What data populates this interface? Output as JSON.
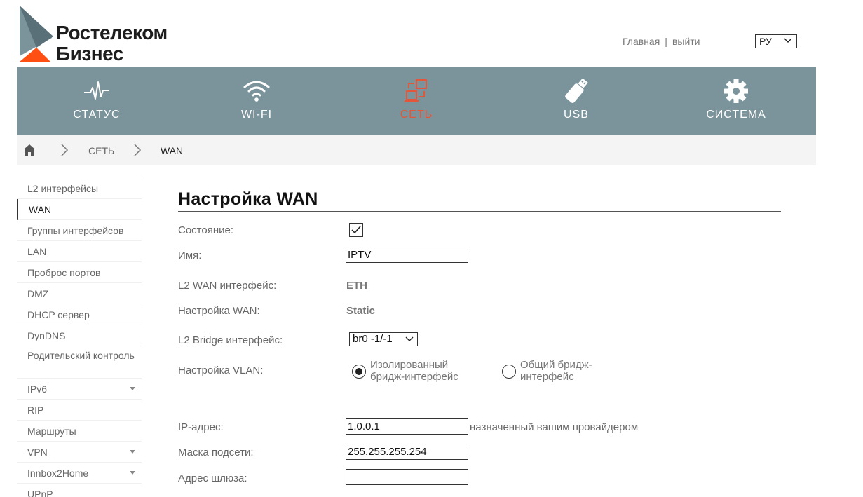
{
  "brand": {
    "line1": "Ростелеком",
    "line2": "Бизнес"
  },
  "top_links": {
    "home": "Главная",
    "separator": "|",
    "logout": "выйти"
  },
  "language": {
    "selected": "РУ"
  },
  "nav": [
    {
      "label": "СТАТУС",
      "icon": "pulse-icon"
    },
    {
      "label": "WI-FI",
      "icon": "wifi-icon"
    },
    {
      "label": "СЕТЬ",
      "icon": "network-icon"
    },
    {
      "label": "USB",
      "icon": "usb-icon"
    },
    {
      "label": "СИСТЕМА",
      "icon": "gear-icon"
    }
  ],
  "breadcrumb": {
    "section": "СЕТЬ",
    "page": "WAN"
  },
  "sidebar": [
    {
      "label": "L2 интерфейсы"
    },
    {
      "label": "WAN"
    },
    {
      "label": "Группы интерфейсов"
    },
    {
      "label": "LAN"
    },
    {
      "label": "Проброс портов"
    },
    {
      "label": "DMZ"
    },
    {
      "label": "DHCP сервер"
    },
    {
      "label": "DynDNS"
    },
    {
      "label": "Родительский контроль"
    },
    {
      "label": "IPv6"
    },
    {
      "label": "RIP"
    },
    {
      "label": "Маршруты"
    },
    {
      "label": "VPN"
    },
    {
      "label": "Innbox2Home"
    },
    {
      "label": "UPnP"
    }
  ],
  "form": {
    "title": "Настройка WAN",
    "state_label": "Состояние:",
    "name_label": "Имя:",
    "name_value": "IPTV",
    "l2wan_label": "L2 WAN интерфейс:",
    "l2wan_value": "ETH",
    "wan_setup_label": "Настройка WAN:",
    "wan_setup_value": "Static",
    "bridge_label": "L2 Bridge интерфейс:",
    "bridge_value": "br0 -1/-1",
    "vlan_label": "Настройка VLAN:",
    "vlan_option1": "Изолированный бридж-интерфейс",
    "vlan_option2": "Общий бридж-интерфейс",
    "ip_label": "IP-адрес:",
    "ip_value": "1.0.0.1",
    "ip_hint": "назначенный вашим провайдером",
    "mask_label": "Маска подсети:",
    "mask_value": "255.255.255.254",
    "gateway_label": "Адрес шлюза:",
    "gateway_value": ""
  },
  "colors": {
    "navbar": "#7b939b",
    "active": "#e4563a",
    "brand_orange": "#ff4f12"
  }
}
